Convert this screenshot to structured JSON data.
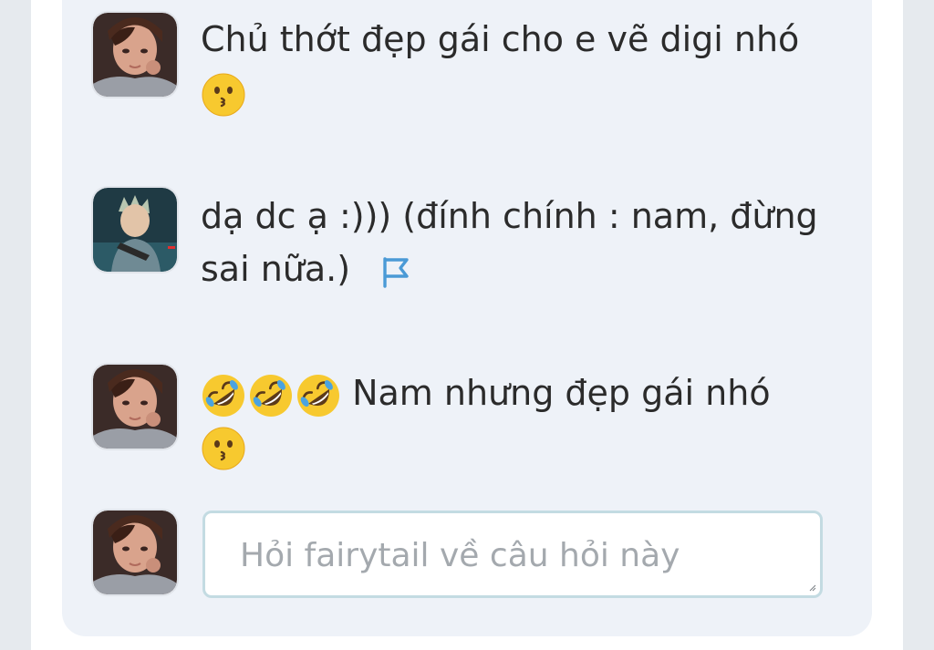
{
  "comments": [
    {
      "author_avatar": "avatar-girl-photo",
      "text_before": "",
      "text": "Chủ thớt đẹp gái cho e vẽ digi nhó",
      "emoji_after": "kissing-face"
    },
    {
      "author_avatar": "avatar-anime-boy",
      "text": "dạ dc ạ :))) (đính chính : nam, đừng sai nữa.)",
      "action_icon": "flag-icon"
    },
    {
      "author_avatar": "avatar-girl-photo",
      "emoji_before": [
        "rolling-on-floor-laughing",
        "rolling-on-floor-laughing",
        "rolling-on-floor-laughing"
      ],
      "text": " Nam nhưng đẹp gái nhó",
      "emoji_after": "kissing-face"
    }
  ],
  "composer": {
    "avatar": "avatar-girl-photo",
    "placeholder": "Hỏi fairytail về câu hỏi này",
    "value": ""
  },
  "colors": {
    "thread_background": "#eef2f8",
    "text": "#2b2b2b",
    "flag": "#4a9ad6",
    "input_border": "#c3dbe2",
    "placeholder": "#a4a9ae"
  }
}
